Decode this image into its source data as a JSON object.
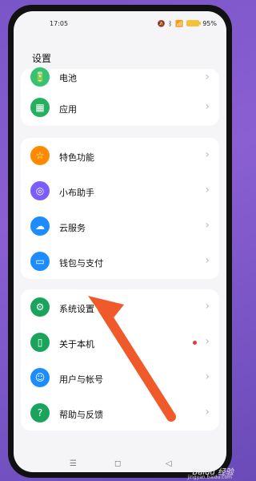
{
  "statusbar": {
    "time": "17:05",
    "battery": "95%"
  },
  "page": {
    "title": "设置"
  },
  "groups": [
    {
      "items": [
        {
          "label": "电池",
          "icon": "battery-icon",
          "color": "#38c172"
        },
        {
          "label": "应用",
          "icon": "apps-icon",
          "color": "#25b05f"
        }
      ]
    },
    {
      "items": [
        {
          "label": "特色功能",
          "icon": "star-icon",
          "color": "#ff8a00"
        },
        {
          "label": "小布助手",
          "icon": "assistant-icon",
          "color": "#7b5cff"
        },
        {
          "label": "云服务",
          "icon": "cloud-icon",
          "color": "#1d8cff"
        },
        {
          "label": "钱包与支付",
          "icon": "wallet-icon",
          "color": "#1d8cff"
        }
      ]
    },
    {
      "items": [
        {
          "label": "系统设置",
          "icon": "gear-icon",
          "color": "#1aa35a"
        },
        {
          "label": "关于本机",
          "icon": "phone-icon",
          "color": "#1aa35a",
          "badge": true
        },
        {
          "label": "用户与帐号",
          "icon": "user-icon",
          "color": "#1d8cff"
        },
        {
          "label": "帮助与反馈",
          "icon": "help-icon",
          "color": "#1aa35a"
        }
      ]
    }
  ],
  "watermark": {
    "text": "Baidu 经验"
  },
  "footer_url": "jingyan.baidu.com"
}
